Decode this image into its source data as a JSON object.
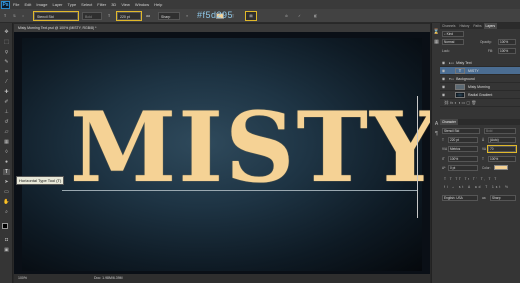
{
  "app": {
    "logo": "Ps"
  },
  "menu": [
    "File",
    "Edit",
    "Image",
    "Layer",
    "Type",
    "Select",
    "Filter",
    "3D",
    "View",
    "Window",
    "Help"
  ],
  "options": {
    "font_family": "Stencil Std",
    "font_style": "Bold",
    "font_size": "220 pt",
    "aa": "aa",
    "aa_mode": "Sharp"
  },
  "canvas": {
    "tab_title": "Misty Morning Text.psd @ 100% (MISTY, RGB/8) *",
    "text": "MISTY",
    "tooltip": "Horizontal Type Tool (T)",
    "color_note": "#f5d295"
  },
  "status": {
    "zoom": "100%",
    "doc": "Doc: 1.98M/6.39M"
  },
  "layers_panel": {
    "tabs": [
      "Channels",
      "History",
      "Paths",
      "Layers"
    ],
    "blend": "Normal",
    "opacity_label": "Opacity:",
    "opacity": "100%",
    "lock_label": "Lock:",
    "fill_label": "Fill:",
    "fill": "100%",
    "layers": [
      {
        "name": "Misty Text",
        "kind": "group"
      },
      {
        "name": "MISTY",
        "kind": "text"
      },
      {
        "name": "Background",
        "kind": "group"
      },
      {
        "name": "Misty Morning",
        "kind": "image"
      },
      {
        "name": "Radial Gradient",
        "kind": "image"
      }
    ]
  },
  "character_panel": {
    "tabs": [
      "Character"
    ],
    "font_family": "Stencil Std",
    "font_style": "Bold",
    "font_size": "220 pt",
    "leading": "(Auto)",
    "kerning": "Metrics",
    "tracking": "70",
    "vscale": "100%",
    "hscale": "100%",
    "baseline": "0 pt",
    "color_label": "Color:",
    "color": "#f5d295",
    "language": "English: USA",
    "aa": "aa",
    "aa_mode": "Sharp"
  }
}
